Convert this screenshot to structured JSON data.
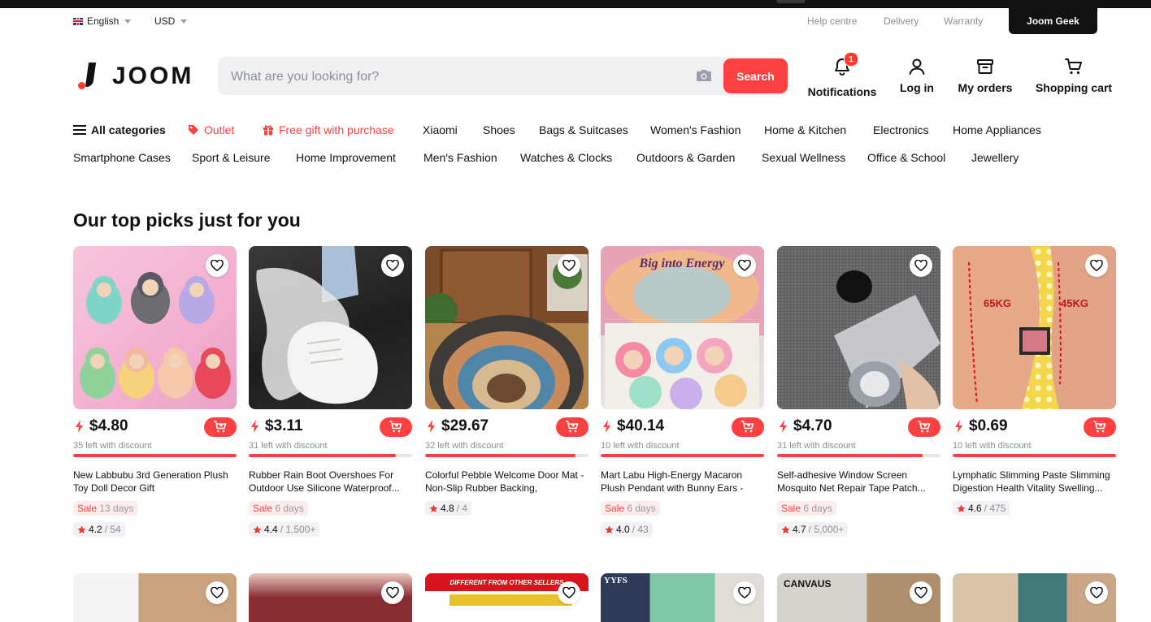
{
  "util": {
    "language": "English",
    "currency": "USD",
    "links": [
      "Help centre",
      "Delivery",
      "Warranty"
    ],
    "geek": "Joom Geek"
  },
  "header": {
    "logo_text": "JOOM",
    "search_placeholder": "What are you looking for?",
    "search_button": "Search",
    "notifications_label": "Notifications",
    "notifications_count": "1",
    "login_label": "Log in",
    "orders_label": "My orders",
    "cart_label": "Shopping cart"
  },
  "categories": {
    "all": "All categories",
    "row1": [
      "Outlet",
      "Free gift with purchase",
      "Xiaomi",
      "Shoes",
      "Bags & Suitcases",
      "Women's Fashion",
      "Home & Kitchen",
      "Electronics",
      "Home Appliances"
    ],
    "row2": [
      "Smartphone Cases",
      "Sport & Leisure",
      "Home Improvement",
      "Men's Fashion",
      "Watches & Clocks",
      "Outdoors & Garden",
      "Sexual Wellness",
      "Office & School",
      "Jewellery"
    ]
  },
  "section_title": "Our top picks just for you",
  "colors": {
    "accent": "#ff4040",
    "text": "#111111",
    "muted": "#8a8f98"
  },
  "products": [
    {
      "price": "$4.80",
      "left": "35 left with discount",
      "progress": 1.0,
      "title": "New Labbubu 3rd Generation Plush Toy Doll Decor Gift",
      "sale_label": "Sale",
      "sale_days": "13 days",
      "rating": "4.2",
      "reviews": "/ 54"
    },
    {
      "price": "$3.11",
      "left": "31 left with discount",
      "progress": 0.9,
      "title": "Rubber Rain Boot Overshoes For Outdoor Use Silicone Waterproof...",
      "sale_label": "Sale",
      "sale_days": "6 days",
      "rating": "4.4",
      "reviews": "/ 1,500+"
    },
    {
      "price": "$29.67",
      "left": "32 left with discount",
      "progress": 0.92,
      "title": "Colorful Pebble Welcome Door Mat - Non-Slip Rubber Backing, Absorben...",
      "sale_label": "",
      "sale_days": "",
      "rating": "4.8",
      "reviews": "/ 4"
    },
    {
      "price": "$40.14",
      "left": "10 left with discount",
      "progress": 1.0,
      "title": "Mart Labu High-Energy Macaron Plush Pendant with Bunny Ears - Cut...",
      "sale_label": "Sale",
      "sale_days": "6 days",
      "rating": "4.0",
      "reviews": "/ 43"
    },
    {
      "price": "$4.70",
      "left": "31 left with discount",
      "progress": 0.89,
      "title": "Self-adhesive Window Screen Mosquito Net Repair Tape Patch...",
      "sale_label": "Sale",
      "sale_days": "6 days",
      "rating": "4.7",
      "reviews": "/ 5,000+"
    },
    {
      "price": "$0.69",
      "left": "10 left with discount",
      "progress": 1.0,
      "title": "Lymphatic Slimming Paste Slimming Digestion Health Vitality Swelling...",
      "sale_label": "",
      "sale_days": "",
      "rating": "4.6",
      "reviews": "/ 475"
    }
  ],
  "image_text": {
    "arm_left": "65KG",
    "arm_right": "45KG",
    "big_into": "Big into Energy",
    "row2_banner": "DIFFERENT FROM OTHER SELLERS",
    "row2_brand": "YYFS",
    "row2_canvas": "CANVAUS"
  }
}
